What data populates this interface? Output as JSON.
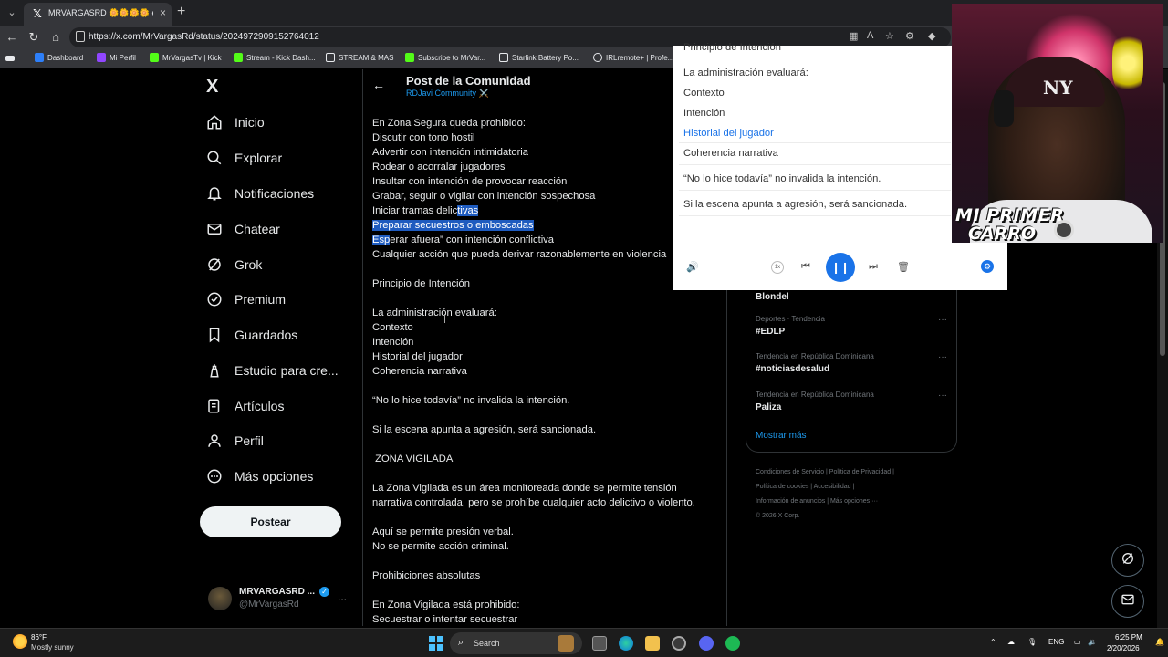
{
  "browser": {
    "tab_title": "MRVARGASRD 🌼🌼🌼🌼 en X: \"",
    "url": "https://x.com/MrVargasRd/status/2024972909152764012",
    "bookmarks": [
      {
        "label": "Dashboard",
        "color": "#2d7ff9"
      },
      {
        "label": "Mi Perfil",
        "color": "#9146ff"
      },
      {
        "label": "MrVargasTv | Kick",
        "color": "#53fc18"
      },
      {
        "label": "Stream - Kick Dash...",
        "color": "#53fc18"
      },
      {
        "label": "STREAM & MAS",
        "color": "#e8eaed"
      },
      {
        "label": "Subscribe to MrVar...",
        "color": "#53fc18"
      },
      {
        "label": "Starlink Battery Po...",
        "color": "#e8eaed"
      },
      {
        "label": "IRLremote+ | Profe...",
        "color": "#e8eaed"
      }
    ]
  },
  "nav": {
    "logo": "X",
    "items": [
      {
        "label": "Inicio",
        "icon": "home-icon"
      },
      {
        "label": "Explorar",
        "icon": "search-icon"
      },
      {
        "label": "Notificaciones",
        "icon": "bell-icon"
      },
      {
        "label": "Chatear",
        "icon": "mail-icon"
      },
      {
        "label": "Grok",
        "icon": "grok-icon"
      },
      {
        "label": "Premium",
        "icon": "premium-icon"
      },
      {
        "label": "Guardados",
        "icon": "bookmark-icon"
      },
      {
        "label": "Estudio para cre...",
        "icon": "studio-icon"
      },
      {
        "label": "Artículos",
        "icon": "articles-icon"
      },
      {
        "label": "Perfil",
        "icon": "person-icon"
      },
      {
        "label": "Más opciones",
        "icon": "more-icon"
      }
    ],
    "post_button": "Postear",
    "profile": {
      "name": "MRVARGASRD ...",
      "handle": "@MrVargasRd",
      "more": "..."
    }
  },
  "post": {
    "header_title": "Post de la Comunidad",
    "community": "RDJavi Community ⚔️",
    "lines": [
      "En Zona Segura queda prohibido:",
      "Discutir con tono hostil",
      "Advertir con intención intimidatoria",
      "Rodear o acorralar jugadores",
      "Insultar con intención de provocar reacción",
      "Grabar, seguir o vigilar con intención sospechosa",
      "Iniciar tramas delictivas",
      "Preparar secuestros o emboscadas",
      "Esperar afuera” con intención conflictiva",
      "Cualquier acción que pueda derivar razonablemente en violencia",
      "",
      "Principio de Intención",
      "",
      "La administración evaluará:",
      "Contexto",
      "Intención",
      "Historial del jugador",
      "Coherencia narrativa",
      "",
      "“No lo hice todavía” no invalida la intención.",
      "",
      "Si la escena apunta a agresión, será sancionada.",
      "",
      " ZONA VIGILADA",
      "",
      "La Zona Vigilada es un área monitoreada donde se permite tensión",
      "narrativa controlada, pero se prohíbe cualquier acto delictivo o violento.",
      "",
      "Aquí se permite presión verbal.",
      "No se permite acción criminal.",
      "",
      "Prohibiciones absolutas",
      "",
      "En Zona Vigilada está prohibido:",
      "Secuestrar o intentar secuestrar"
    ],
    "line6_plain": "Iniciar tramas delic",
    "line6_sel": "tivas",
    "line8_sel": "Esp",
    "line8_plain": "erar afuera” con intención conflictiva"
  },
  "trends": [
    {
      "category": "",
      "title": "Blondel"
    },
    {
      "category": "Deportes · Tendencia",
      "title": "#EDLP"
    },
    {
      "category": "Tendencia en República Dominicana",
      "title": "#noticiasdesalud"
    },
    {
      "category": "Tendencia en República Dominicana",
      "title": "Paliza"
    }
  ],
  "show_more": "Mostrar más",
  "footer": {
    "l1": "Condiciones de Servicio  |  Política de Privacidad  |",
    "l2": "Política de cookies  |  Accesibilidad  |",
    "l3": "Información de anuncios  |  Más opciones ···",
    "l4": "© 2026 X Corp."
  },
  "reader": {
    "lines": [
      "Principio de Intención",
      "La administración evaluará:",
      "Contexto",
      "Intención",
      "Historial del jugador",
      "Coherencia narrativa",
      "“No lo hice todavía” no invalida la intención.",
      "Si la escena apunta a agresión, será sancionada."
    ],
    "speed": "1x",
    "accent": "#1a73e8"
  },
  "webcam": {
    "banner_line1": "MI PRIMER",
    "banner_line2": "CARRO",
    "cap_logo": "NY"
  },
  "taskbar": {
    "temp": "86°F",
    "weather": "Mostly sunny",
    "search": "Search",
    "lang": "ENG",
    "time": "6:25 PM",
    "date": "2/20/2026"
  }
}
